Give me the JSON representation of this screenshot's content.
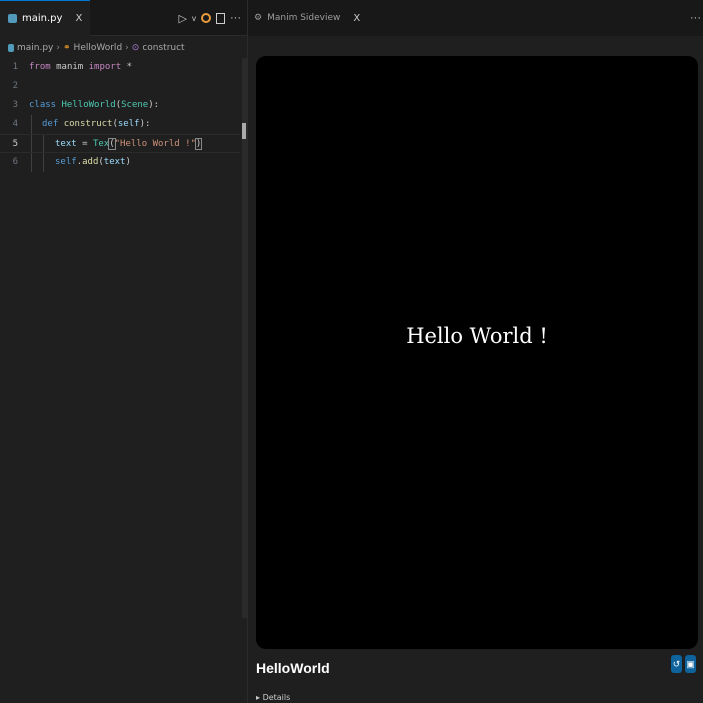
{
  "editor": {
    "tab_label": "main.py",
    "tab_close": "X",
    "breadcrumb": {
      "file": "main.py",
      "class": "HelloWorld",
      "method": "construct"
    },
    "line_numbers": [
      "1",
      "2",
      "3",
      "4",
      "5",
      "6"
    ],
    "code": {
      "l1": {
        "kw": "from",
        "mod": "manim",
        "kw2": "import",
        "rest": "*"
      },
      "l3": {
        "kw": "class",
        "name": "HelloWorld",
        "open": "(",
        "base": "Scene",
        "close": "):"
      },
      "l4": {
        "kw": "def",
        "name": "construct",
        "open": "(",
        "arg": "self",
        "close": "):"
      },
      "l5": {
        "var": "text",
        "eq": " = ",
        "fn": "Tex",
        "open": "(",
        "str": "\"Hello World !\"",
        "close": ")"
      },
      "l6": {
        "obj": "self",
        "dot": ".",
        "fn": "add",
        "open": "(",
        "arg": "text",
        "close": ")"
      }
    },
    "actions": {
      "run": "▷",
      "run_dropdown": "v",
      "more": "···"
    }
  },
  "sideview": {
    "tab_label": "Manim Sideview",
    "tab_close": "X",
    "more": "···",
    "preview_text": "Hello World !",
    "scene_name": "HelloWorld",
    "details_label": "Details"
  },
  "colors": {
    "accent": "#0078d4",
    "preview_bg": "#000000",
    "button": "#0e639c"
  }
}
